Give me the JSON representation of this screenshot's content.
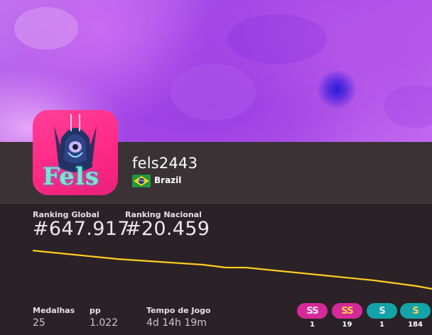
{
  "profile": {
    "username": "fels2443",
    "country": "Brazil",
    "avatar_text": "Fels"
  },
  "ranks": {
    "global_label": "Ranking Global",
    "global_value": "#647.917",
    "national_label": "Ranking Nacional",
    "national_value": "#20.459"
  },
  "stats": {
    "medals_label": "Medalhas",
    "medals_value": "25",
    "pp_label": "pp",
    "pp_value": "1.022",
    "playtime_label": "Tempo de Jogo",
    "playtime_value": "4d 14h 19m"
  },
  "grades": [
    {
      "grade": "SS",
      "count": "1",
      "variant": "silver",
      "bg": "#d6299a",
      "fg": "#e8e8ee"
    },
    {
      "grade": "SS",
      "count": "19",
      "variant": "gold",
      "bg": "#d6299a",
      "fg": "#ffd24a"
    },
    {
      "grade": "S",
      "count": "1",
      "variant": "silver",
      "bg": "#14a3a8",
      "fg": "#e8e8ee"
    },
    {
      "grade": "S",
      "count": "184",
      "variant": "gold",
      "bg": "#14a3a8",
      "fg": "#ffd24a"
    }
  ],
  "colors": {
    "graph_line": "#ffcc22",
    "header_band": "#3a3235",
    "background": "#2a2226",
    "avatar_bg": "#ff2a84"
  },
  "icons": {
    "flag": "brazil-flag-icon"
  }
}
